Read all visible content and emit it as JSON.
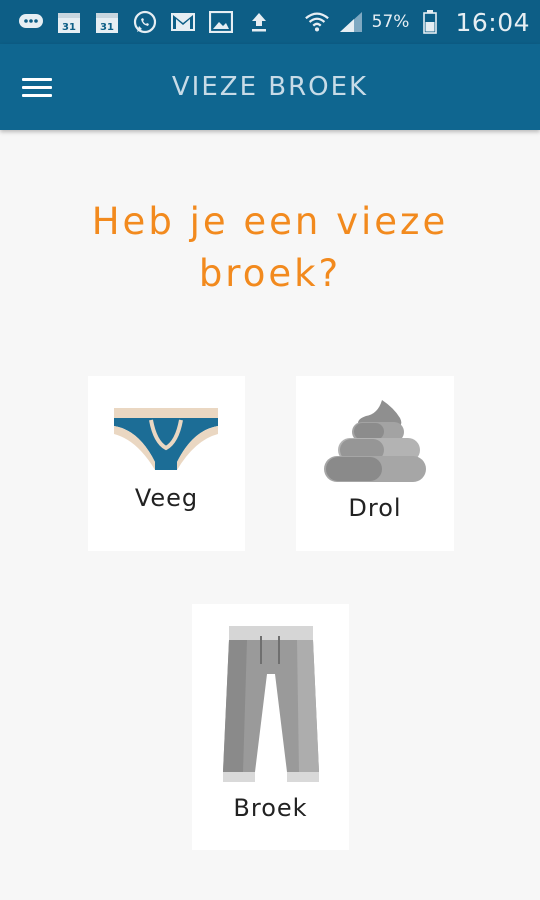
{
  "status_bar": {
    "icons": [
      "messages-icon",
      "calendar-icon",
      "calendar-icon",
      "whatsapp-icon",
      "gmail-icon",
      "gallery-icon",
      "upload-icon",
      "wifi-icon",
      "signal-icon"
    ],
    "calendar_day": "31",
    "battery_percent": "57%",
    "time": "16:04"
  },
  "app_bar": {
    "title": "VIEZE BROEK",
    "color": "#0f6690"
  },
  "main": {
    "question": "Heb je een vieze broek?",
    "accent_color": "#f28a1e",
    "options": [
      {
        "label": "Veeg",
        "icon": "underwear-icon"
      },
      {
        "label": "Drol",
        "icon": "poop-icon"
      },
      {
        "label": "Broek",
        "icon": "pants-icon"
      }
    ]
  }
}
